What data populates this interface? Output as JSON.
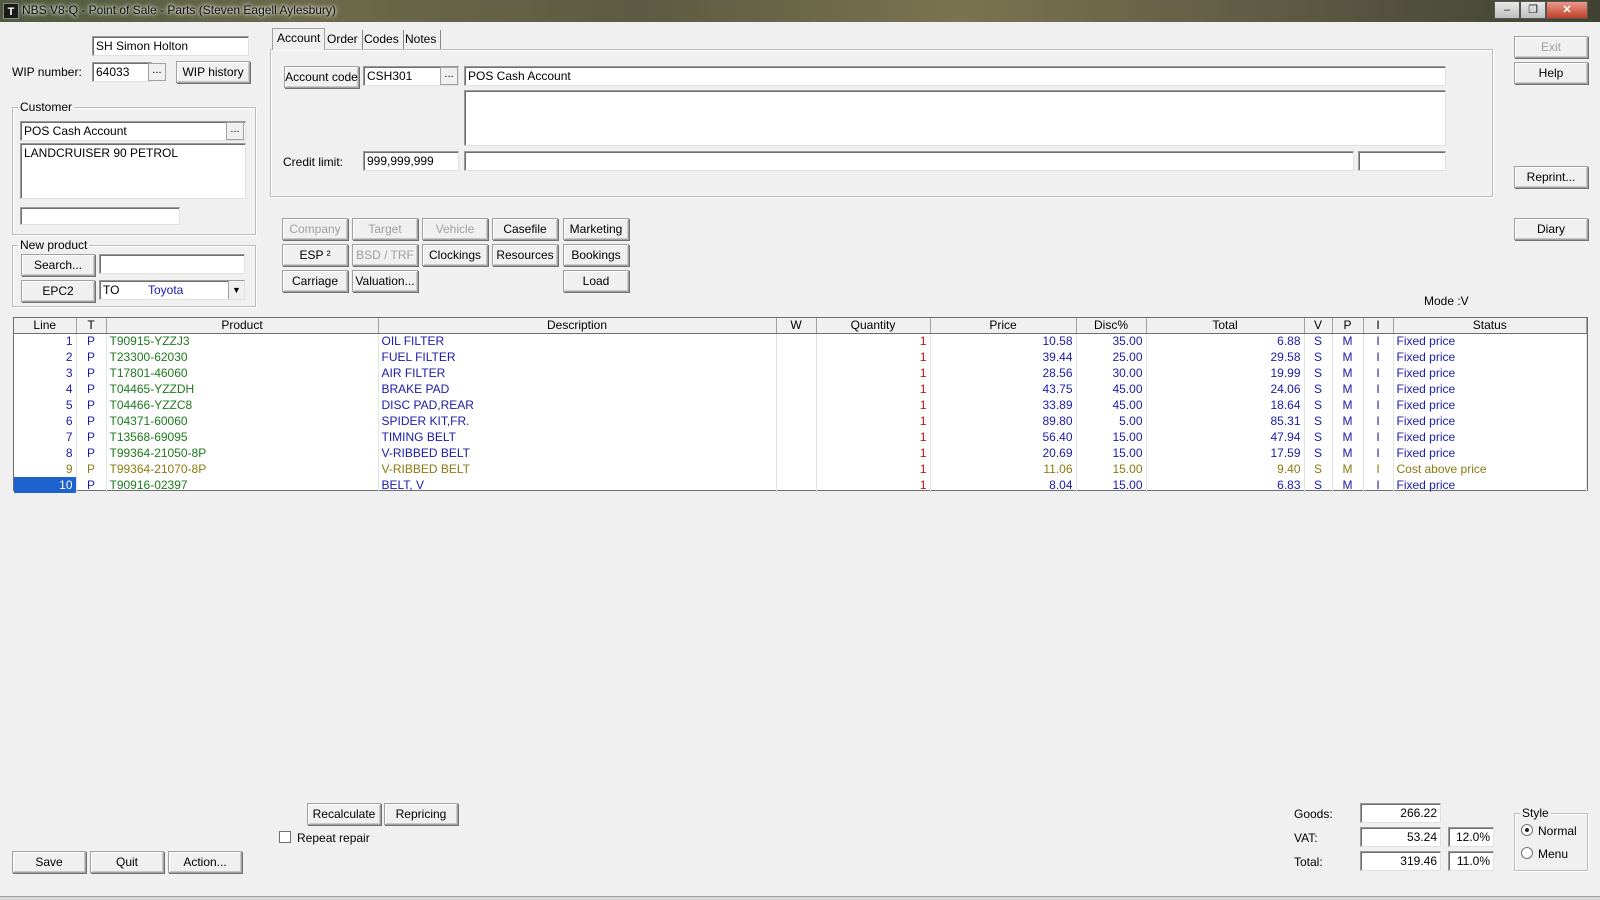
{
  "window": {
    "title": "NBS V8-Q - Point of Sale - Parts (Steven Eagell Aylesbury)",
    "icon": "T"
  },
  "header": {
    "salesperson": "SH   Simon  Holton",
    "wip_label": "WIP number:",
    "wip_value": "64033",
    "wip_history": "WIP history"
  },
  "customer": {
    "group_label": "Customer",
    "name": "POS Cash Account",
    "address": "LANDCRUISER 90 PETROL",
    "extra": ""
  },
  "new_product": {
    "group_label": "New product",
    "search_button": "Search...",
    "search_value": "",
    "epc_button": "EPC2",
    "make_code": "TO",
    "make_name": "Toyota"
  },
  "tabs": [
    {
      "label": "Account",
      "active": true
    },
    {
      "label": "Order"
    },
    {
      "label": "Codes"
    },
    {
      "label": "Notes"
    }
  ],
  "account": {
    "account_code_button": "Account code",
    "account_code": "CSH301",
    "account_name": "POS Cash Account",
    "credit_label": "Credit limit:",
    "credit_limit": "999,999,999"
  },
  "right_buttons": {
    "exit": "Exit",
    "help": "Help",
    "reprint": "Reprint...",
    "diary": "Diary"
  },
  "action_buttons": {
    "company": "Company",
    "target": "Target",
    "vehicle": "Vehicle",
    "casefile": "Casefile",
    "marketing": "Marketing",
    "esp": "ESP ²",
    "bsd": "BSD / TRF",
    "clockings": "Clockings",
    "resources": "Resources",
    "bookings": "Bookings",
    "carriage": "Carriage",
    "valuation": "Valuation...",
    "load": "Load"
  },
  "mode": "Mode :V",
  "grid": {
    "columns": [
      "Line",
      "T",
      "Product",
      "Description",
      "W",
      "Quantity",
      "Price",
      "Disc%",
      "Total",
      "V",
      "P",
      "I",
      "Status"
    ],
    "rows": [
      {
        "line": "1",
        "t": "P",
        "product": "T90915-YZZJ3",
        "description": "OIL FILTER",
        "w": "",
        "qty": "1",
        "price": "10.58",
        "disc": "35.00",
        "total": "6.88",
        "v": "S",
        "p": "M",
        "i": "I",
        "status": "Fixed price",
        "style": "normal"
      },
      {
        "line": "2",
        "t": "P",
        "product": "T23300-62030",
        "description": "FUEL FILTER",
        "w": "",
        "qty": "1",
        "price": "39.44",
        "disc": "25.00",
        "total": "29.58",
        "v": "S",
        "p": "M",
        "i": "I",
        "status": "Fixed price",
        "style": "normal"
      },
      {
        "line": "3",
        "t": "P",
        "product": "T17801-46060",
        "description": "AIR FILTER",
        "w": "",
        "qty": "1",
        "price": "28.56",
        "disc": "30.00",
        "total": "19.99",
        "v": "S",
        "p": "M",
        "i": "I",
        "status": "Fixed price",
        "style": "normal"
      },
      {
        "line": "4",
        "t": "P",
        "product": "T04465-YZZDH",
        "description": "BRAKE PAD",
        "w": "",
        "qty": "1",
        "price": "43.75",
        "disc": "45.00",
        "total": "24.06",
        "v": "S",
        "p": "M",
        "i": "I",
        "status": "Fixed price",
        "style": "normal"
      },
      {
        "line": "5",
        "t": "P",
        "product": "T04466-YZZC8",
        "description": "DISC PAD,REAR",
        "w": "",
        "qty": "1",
        "price": "33.89",
        "disc": "45.00",
        "total": "18.64",
        "v": "S",
        "p": "M",
        "i": "I",
        "status": "Fixed price",
        "style": "normal"
      },
      {
        "line": "6",
        "t": "P",
        "product": "T04371-60060",
        "description": "SPIDER KIT,FR.",
        "w": "",
        "qty": "1",
        "price": "89.80",
        "disc": "5.00",
        "total": "85.31",
        "v": "S",
        "p": "M",
        "i": "I",
        "status": "Fixed price",
        "style": "normal"
      },
      {
        "line": "7",
        "t": "P",
        "product": "T13568-69095",
        "description": "TIMING BELT",
        "w": "",
        "qty": "1",
        "price": "56.40",
        "disc": "15.00",
        "total": "47.94",
        "v": "S",
        "p": "M",
        "i": "I",
        "status": "Fixed price",
        "style": "normal"
      },
      {
        "line": "8",
        "t": "P",
        "product": "T99364-21050-8P",
        "description": "V-RIBBED BELT",
        "w": "",
        "qty": "1",
        "price": "20.69",
        "disc": "15.00",
        "total": "17.59",
        "v": "S",
        "p": "M",
        "i": "I",
        "status": "Fixed price",
        "style": "normal"
      },
      {
        "line": "9",
        "t": "P",
        "product": "T99364-21070-8P",
        "description": "V-RIBBED BELT",
        "w": "",
        "qty": "1",
        "price": "11.06",
        "disc": "15.00",
        "total": "9.40",
        "v": "S",
        "p": "M",
        "i": "I",
        "status": "Cost above price",
        "style": "warning"
      },
      {
        "line": "10",
        "t": "P",
        "product": "T90916-02397",
        "description": "BELT, V",
        "w": "",
        "qty": "1",
        "price": "8.04",
        "disc": "15.00",
        "total": "6.83",
        "v": "S",
        "p": "M",
        "i": "I",
        "status": "Fixed price",
        "style": "normal",
        "selected": true
      }
    ]
  },
  "bottom": {
    "recalculate": "Recalculate",
    "repricing": "Repricing",
    "repeat_repair": "Repeat repair",
    "save": "Save",
    "quit": "Quit",
    "action": "Action..."
  },
  "totals": {
    "goods_label": "Goods:",
    "goods": "266.22",
    "vat_label": "VAT:",
    "vat": "53.24",
    "vat_rate": "12.0%",
    "total_label": "Total:",
    "total": "319.46",
    "total_rate": "11.0%"
  },
  "style_group": {
    "label": "Style",
    "options": [
      "Normal",
      "Menu"
    ],
    "selected": "Normal"
  },
  "colors": {
    "text_blue": "#1a1aa8",
    "text_green": "#1c7a1c",
    "qty_red": "#c01818",
    "warning_olive": "#8a7a10",
    "selection": "#1e62d0"
  }
}
